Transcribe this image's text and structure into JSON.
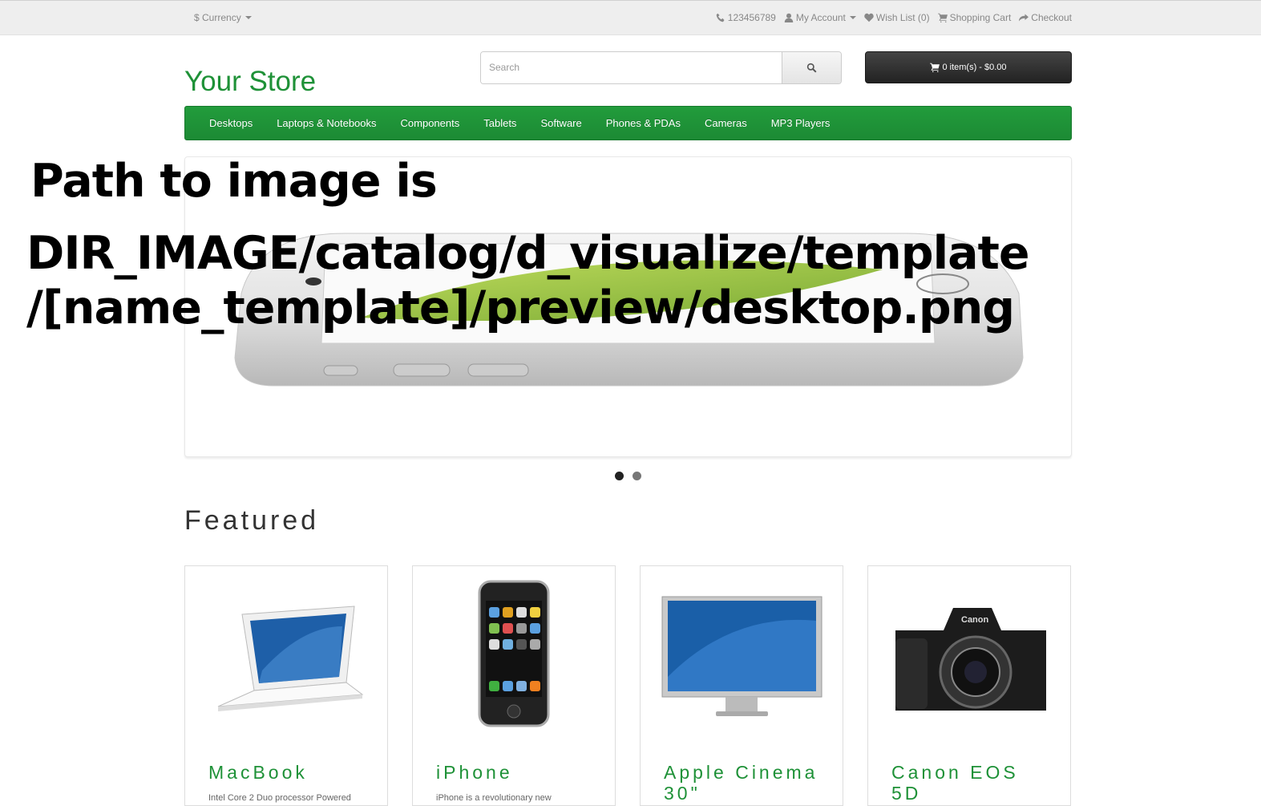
{
  "topbar": {
    "currency_label": "$ Currency",
    "phone": "123456789",
    "my_account": "My Account",
    "wish_list": "Wish List (0)",
    "shopping_cart": "Shopping Cart",
    "checkout": "Checkout"
  },
  "header": {
    "logo": "Your Store",
    "search_placeholder": "Search",
    "cart_label": "0 item(s) - $0.00"
  },
  "menu": [
    "Desktops",
    "Laptops & Notebooks",
    "Components",
    "Tablets",
    "Software",
    "Phones & PDAs",
    "Cameras",
    "MP3 Players"
  ],
  "overlay": {
    "line1": "Path to image is",
    "line2": "DIR_IMAGE/catalog/d_visualize/template",
    "line3": "/[name_template]/preview/desktop.png"
  },
  "featured": {
    "title": "Featured",
    "products": [
      {
        "name": "MacBook",
        "desc": "Intel Core 2 Duo processor Powered"
      },
      {
        "name": "iPhone",
        "desc": "iPhone is a revolutionary new"
      },
      {
        "name": "Apple Cinema 30\"",
        "desc": ""
      },
      {
        "name": "Canon EOS 5D",
        "desc": ""
      }
    ]
  },
  "colors": {
    "brand": "#1e9137",
    "menu": "#229c3c",
    "cart": "#222222"
  }
}
